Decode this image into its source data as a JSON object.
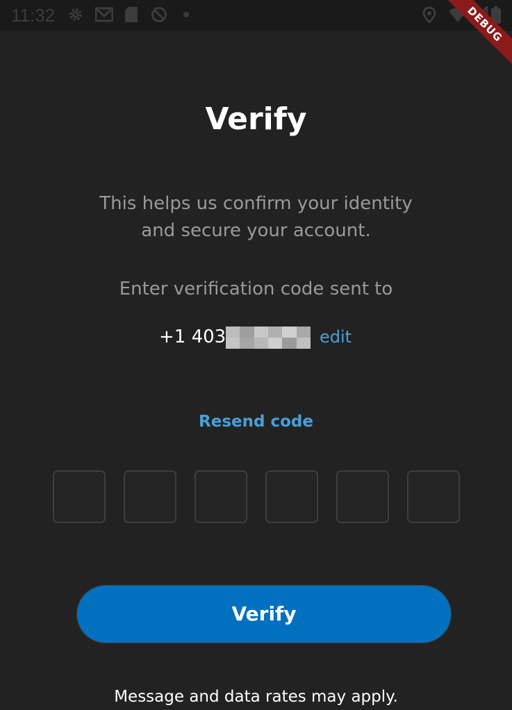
{
  "status_bar": {
    "time": "11:32",
    "left_icons": [
      "gear-icon",
      "gmail-icon",
      "sd-card-icon",
      "do-not-disturb-icon"
    ],
    "right_icons": [
      "location-icon",
      "wifi-icon",
      "signal-icon",
      "battery-icon"
    ]
  },
  "debug_banner": "DEBUG",
  "title": "Verify",
  "subtitle": {
    "line1": "This helps us confirm your identity",
    "line2": "and secure your account."
  },
  "enter_code_label": "Enter verification code sent to",
  "phone": {
    "visible_prefix": "+1 403-",
    "edit_label": "edit"
  },
  "resend_label": "Resend code",
  "code_inputs": {
    "count": 6,
    "values": [
      "",
      "",
      "",
      "",
      "",
      ""
    ]
  },
  "verify_button_label": "Verify",
  "disclaimer": "Message and data rates may apply.",
  "colors": {
    "background": "#222222",
    "accent_link": "#4a9fd8",
    "button_primary": "#0070bf",
    "muted_text": "#9a9a9a",
    "debug_ribbon": "#8b1a1a"
  }
}
